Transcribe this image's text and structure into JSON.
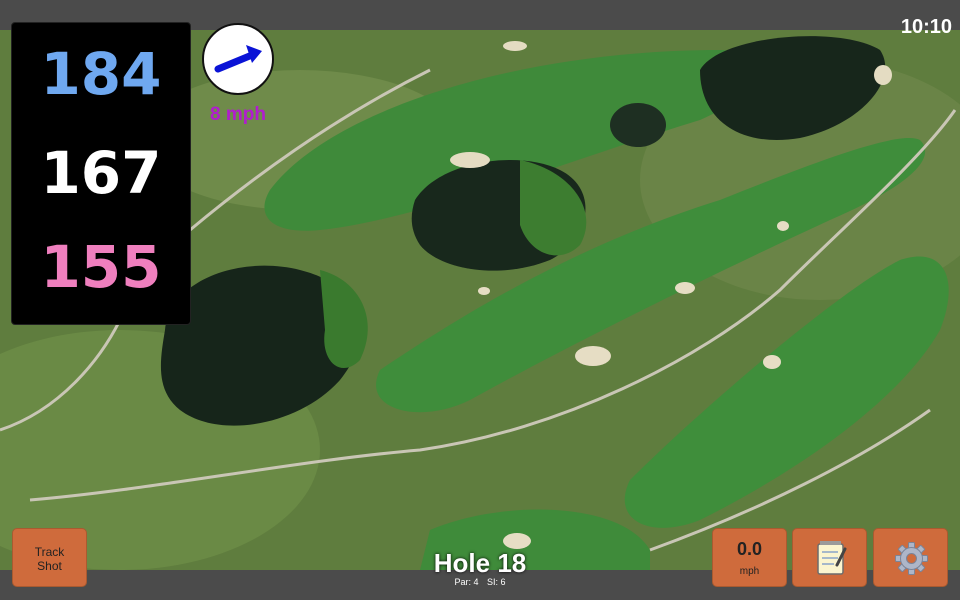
{
  "clock": "10:10",
  "distances": {
    "back": "184",
    "middle": "167",
    "front": "155"
  },
  "colors": {
    "back": "#6fa8f0",
    "middle": "#ffffff",
    "front": "#ef7fbe",
    "wind_text": "#b21ccf",
    "button": "#cf6b3c"
  },
  "wind": {
    "speed_label": "8 mph",
    "icon": "wind-direction-arrow-icon"
  },
  "buttons": {
    "track_shot": "Track\nShot",
    "speed_value": "0.0",
    "speed_unit": "mph",
    "notes_icon": "notepad-icon",
    "settings_icon": "gear-icon"
  },
  "hole": {
    "title": "Hole 18",
    "par": "Par: 4",
    "si": "SI: 6"
  }
}
